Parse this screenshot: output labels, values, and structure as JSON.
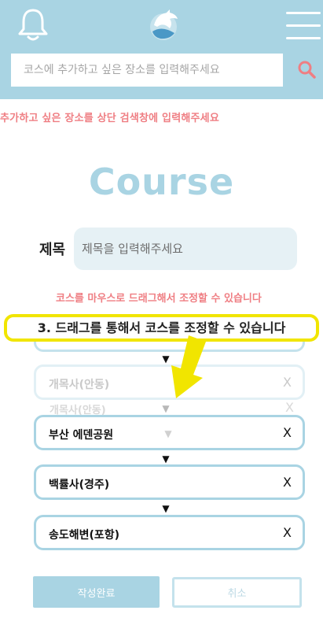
{
  "header": {
    "search_placeholder": "코스에 추가하고 싶은 장소를 입력해주세요",
    "notification_icon": "bell-icon",
    "logo_icon": "dolphin-logo-icon",
    "menu_icon": "hamburger-menu-icon",
    "search_icon": "search-icon"
  },
  "hint_top": "추가하고 싶은 장소를 상단 검색창에 입력해주세요",
  "page_title": "Course",
  "title_field": {
    "label": "제목",
    "placeholder": "제목을 입력해주세요"
  },
  "drag_hint": "코스를 마우스로 드래그해서 조정할 수 있습니다",
  "tutorial_callout": "3. 드래그를 통해서 코스를 조정할 수 있습니다",
  "dragging_items": [
    {
      "name": "개목사(안동)",
      "remove": "X"
    },
    {
      "name": "개목사(안동)",
      "remove": "X"
    }
  ],
  "course_items": [
    {
      "name": "부산 에덴공원",
      "remove": "X"
    },
    {
      "name": "백률사(경주)",
      "remove": "X"
    },
    {
      "name": "송도해변(포항)",
      "remove": "X"
    }
  ],
  "arrow_glyph": "▼",
  "buttons": {
    "submit": "작성완료",
    "cancel": "취소"
  },
  "colors": {
    "brand": "#a9d4e3",
    "hint": "#ef7e83",
    "callout_border": "#f1e500"
  }
}
